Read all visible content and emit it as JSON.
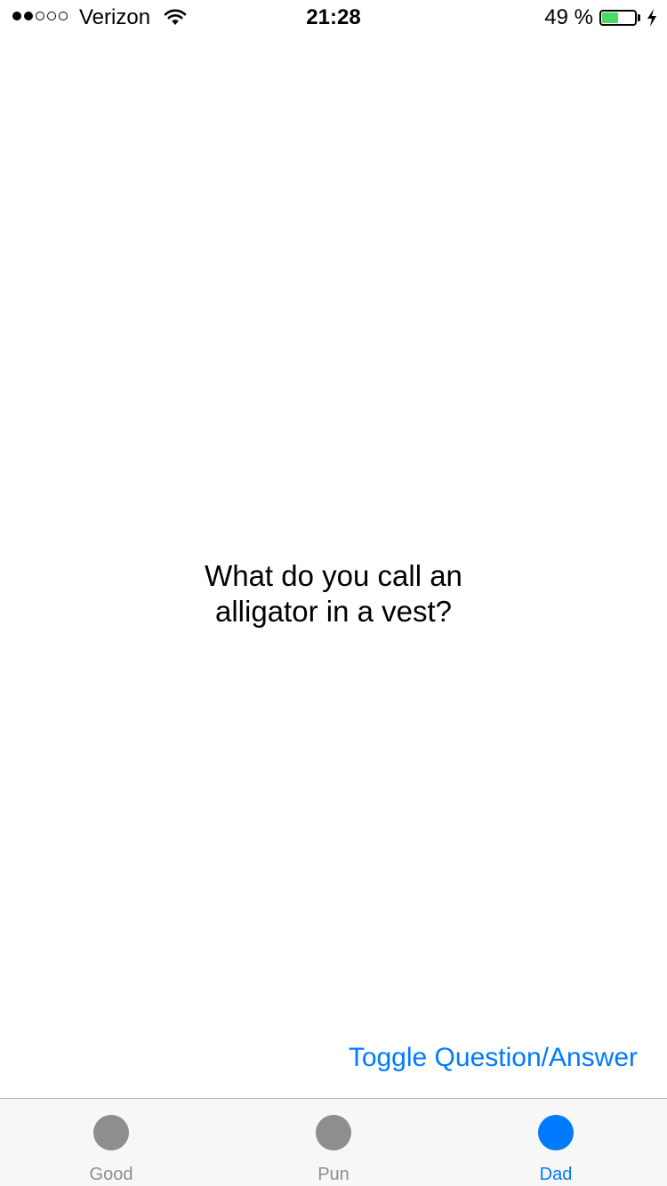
{
  "status_bar": {
    "signal_bars_filled": 2,
    "signal_bars_total": 5,
    "carrier": "Verizon",
    "time": "21:28",
    "battery_percent": "49 %",
    "battery_level": 0.49,
    "battery_color": "#4cd964",
    "charging": true
  },
  "content": {
    "joke_text": "What do you call an\nalligator in a vest?",
    "toggle_label": "Toggle Question/Answer",
    "accent_color": "#007aff"
  },
  "tab_bar": {
    "selected": 2,
    "active_color": "#007aff",
    "inactive_color": "#8e8e8e",
    "tabs": [
      {
        "label": "Good",
        "icon": "circle-icon"
      },
      {
        "label": "Pun",
        "icon": "circle-icon"
      },
      {
        "label": "Dad",
        "icon": "circle-icon"
      }
    ]
  }
}
